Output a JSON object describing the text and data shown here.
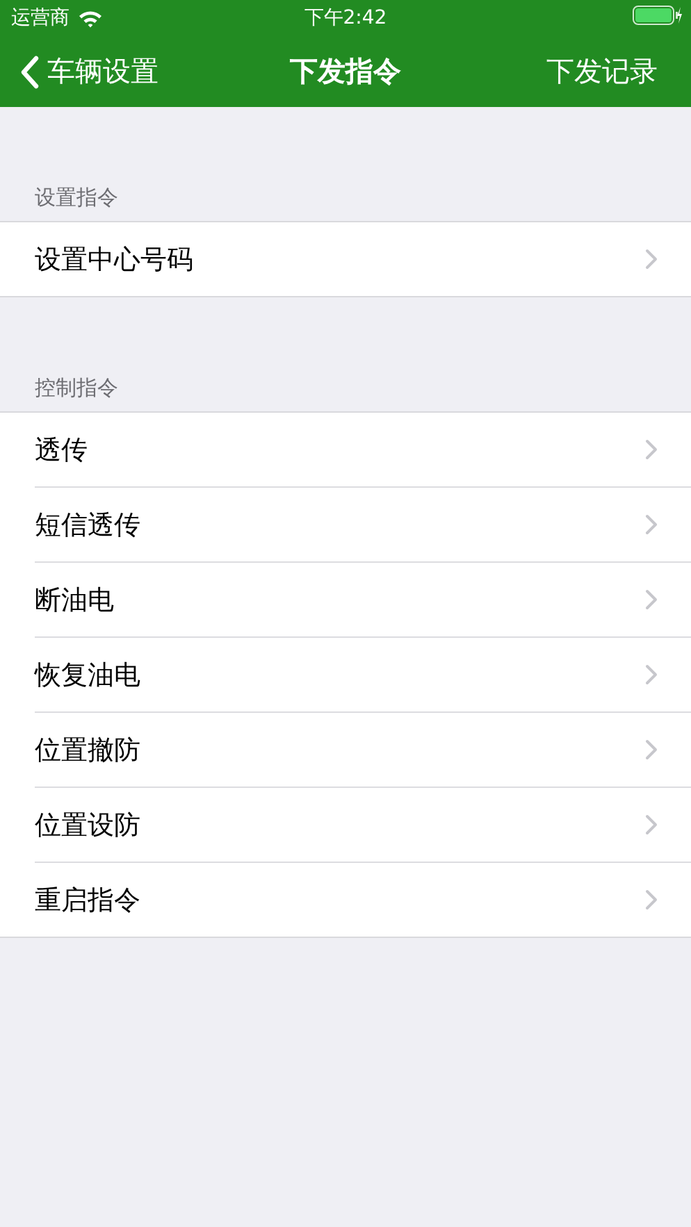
{
  "status_bar": {
    "carrier": "运营商",
    "time": "下午2:42"
  },
  "nav_bar": {
    "back": "车辆设置",
    "title": "下发指令",
    "action": "下发记录"
  },
  "sections": [
    {
      "header": "设置指令",
      "items": [
        "设置中心号码"
      ]
    },
    {
      "header": "控制指令",
      "items": [
        "透传",
        "短信透传",
        "断油电",
        "恢复油电",
        "位置撤防",
        "位置设防",
        "重启指令"
      ]
    }
  ]
}
